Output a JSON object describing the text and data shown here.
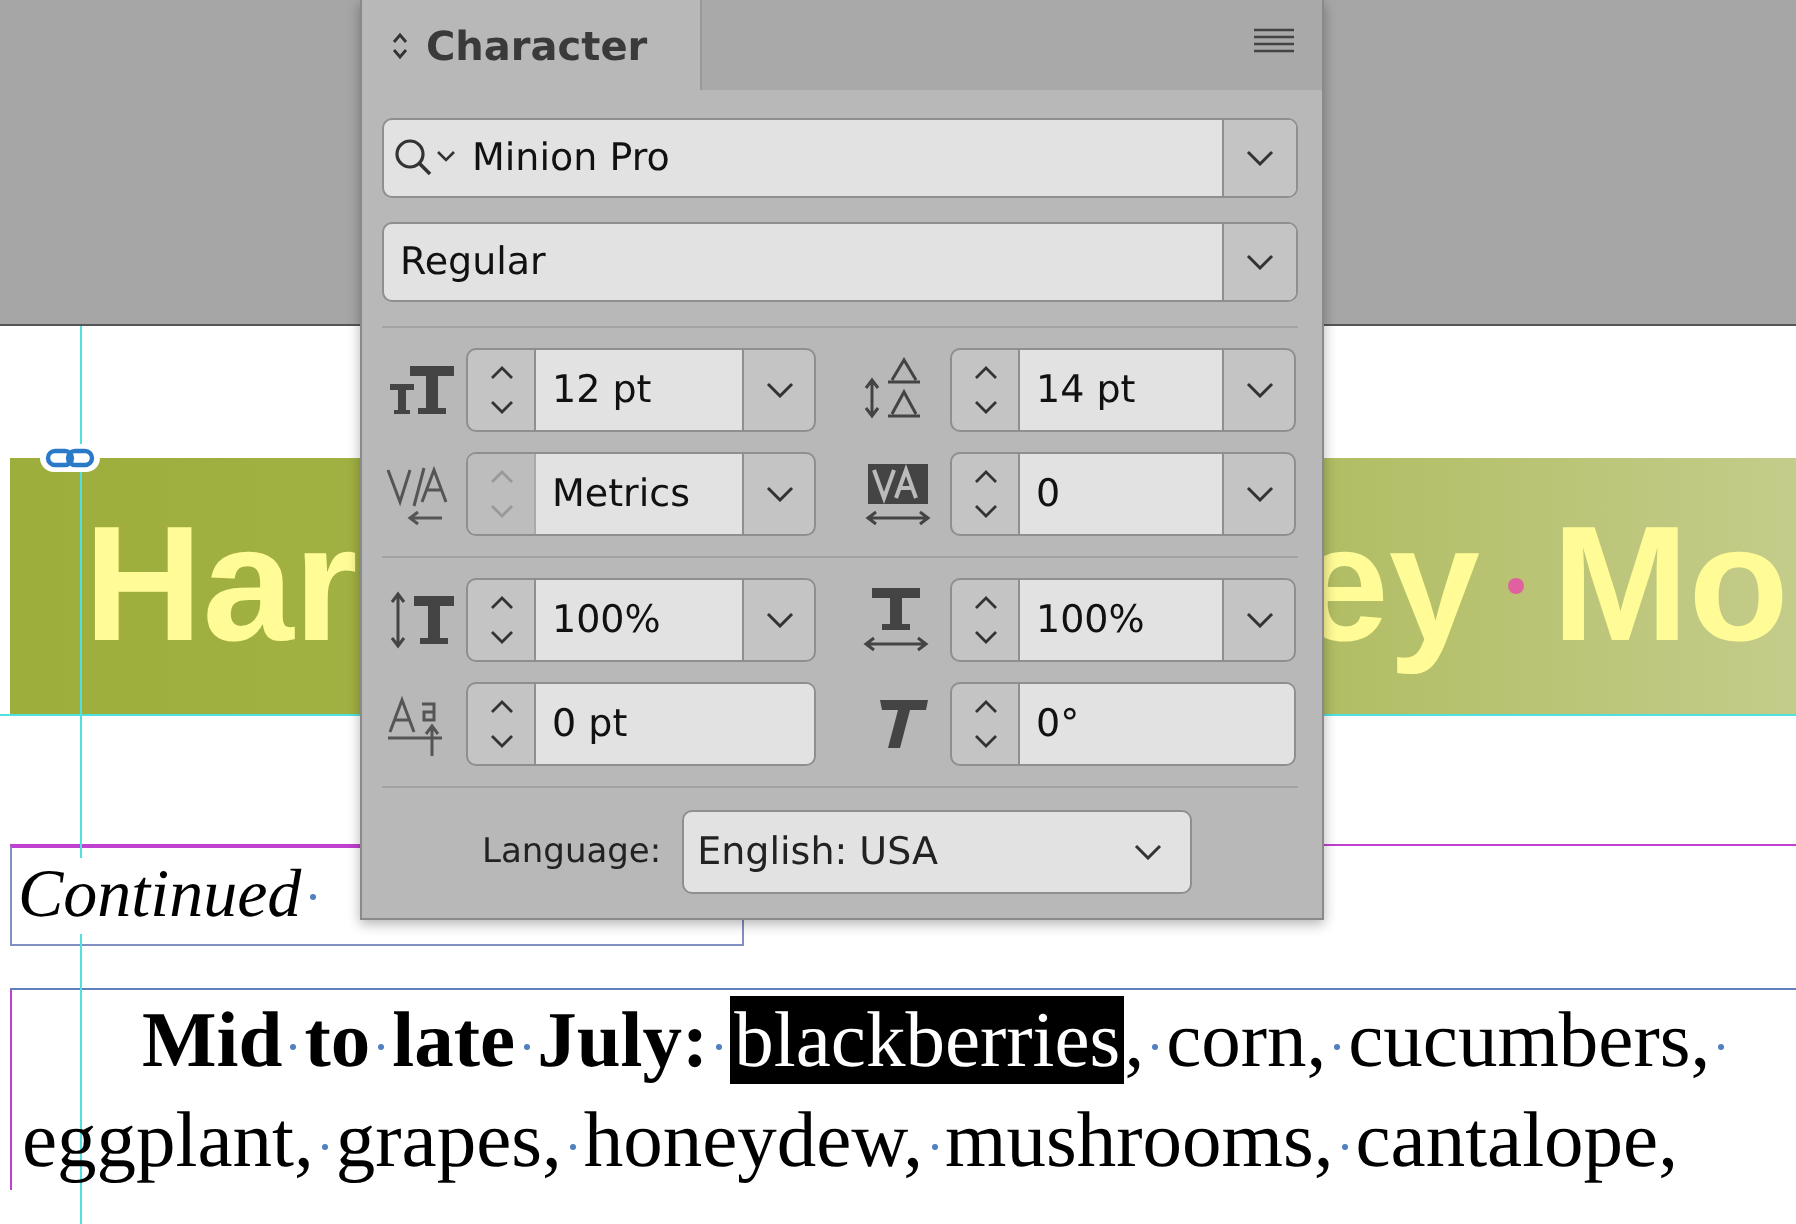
{
  "document": {
    "banner": {
      "left": "Har",
      "right": "ey",
      "right_end": "Mo"
    },
    "subhead": "Continued",
    "lines": [
      [
        {
          "text": "Mid to late July:",
          "bold": true,
          "selected": false,
          "space_after": true
        },
        {
          "text": "blackberries",
          "bold": false,
          "selected": true,
          "space_after": false
        },
        {
          "text": ", corn, cucumbers,",
          "bold": false,
          "selected": false,
          "space_after": true
        }
      ],
      [
        {
          "text": "eggplant, grapes, honeydew, mushrooms, cantalope,",
          "bold": false,
          "selected": false,
          "space_after": false
        }
      ]
    ]
  },
  "panel": {
    "tab": "Character",
    "font_family": "Minion Pro",
    "font_style": "Regular",
    "groups": [
      [
        {
          "kind": "font-size",
          "value": "12 pt",
          "dropdown": true,
          "stepper_disabled": false
        },
        {
          "kind": "leading",
          "value": "14 pt",
          "dropdown": true,
          "stepper_disabled": false
        },
        {
          "kind": "kerning",
          "value": "Metrics",
          "dropdown": true,
          "stepper_disabled": true
        },
        {
          "kind": "tracking",
          "value": "0",
          "dropdown": true,
          "stepper_disabled": false
        }
      ],
      [
        {
          "kind": "vertical-scale",
          "value": "100%",
          "dropdown": true,
          "stepper_disabled": false
        },
        {
          "kind": "horizontal-scale",
          "value": "100%",
          "dropdown": true,
          "stepper_disabled": false
        },
        {
          "kind": "baseline-shift",
          "value": "0 pt",
          "dropdown": false,
          "stepper_disabled": false
        },
        {
          "kind": "skew",
          "value": "0°",
          "dropdown": false,
          "stepper_disabled": false
        }
      ]
    ],
    "language_label": "Language:",
    "language": "English: USA"
  }
}
